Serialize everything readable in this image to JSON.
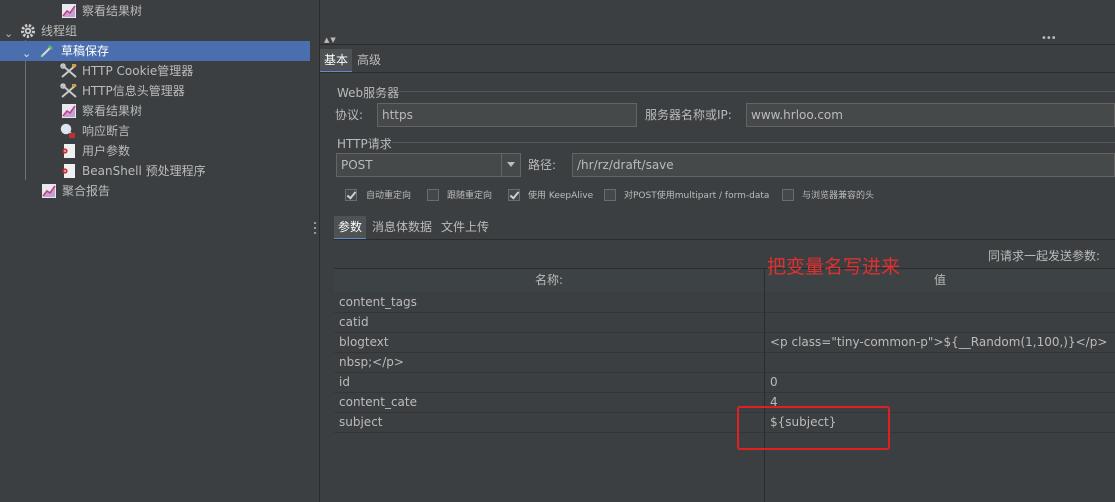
{
  "tree": {
    "items": [
      {
        "label": "察看结果树",
        "icon": "graph-icon"
      },
      {
        "label": "线程组",
        "icon": "gear-icon"
      },
      {
        "label": "草稿保存",
        "icon": "pipette-icon"
      },
      {
        "label": "HTTP Cookie管理器",
        "icon": "wrench-icon"
      },
      {
        "label": "HTTP信息头管理器",
        "icon": "wrench-icon"
      },
      {
        "label": "察看结果树",
        "icon": "graph-icon"
      },
      {
        "label": "响应断言",
        "icon": "magnifier-icon"
      },
      {
        "label": "用户参数",
        "icon": "document-icon"
      },
      {
        "label": "BeanShell 预处理程序",
        "icon": "document-icon"
      },
      {
        "label": "聚合报告",
        "icon": "graph-icon"
      }
    ]
  },
  "tabs": {
    "basic": "基本",
    "advanced": "高级"
  },
  "web_server": {
    "section_title": "Web服务器",
    "protocol_label": "协议:",
    "protocol_value": "https",
    "server_label": "服务器名称或IP:",
    "server_value": "www.hrloo.com"
  },
  "http_request": {
    "section_title": "HTTP请求",
    "method": "POST",
    "path_label": "路径:",
    "path_value": "/hr/rz/draft/save"
  },
  "options": [
    {
      "label": "自动重定向",
      "checked": true
    },
    {
      "label": "跟随重定向",
      "checked": false
    },
    {
      "label": "使用 KeepAlive",
      "checked": true
    },
    {
      "label": "对POST使用multipart / form-data",
      "checked": false
    },
    {
      "label": "与浏览器兼容的头",
      "checked": false
    }
  ],
  "param_tabs": {
    "params": "参数",
    "body_data": "消息体数据",
    "file_upload": "文件上传"
  },
  "send_params_label": "同请求一起发送参数:",
  "table": {
    "col_name": "名称:",
    "col_value": "值",
    "rows": [
      {
        "name": "content_tags",
        "value": ""
      },
      {
        "name": "catid",
        "value": ""
      },
      {
        "name": "blogtext",
        "value": "<p class=\"tiny-common-p\">${__Random(1,100,)}</p>"
      },
      {
        "name": "nbsp;</p>",
        "value": ""
      },
      {
        "name": "id",
        "value": "0"
      },
      {
        "name": "content_cate",
        "value": "4"
      },
      {
        "name": "subject",
        "value": "${subject}"
      }
    ]
  },
  "annotation": {
    "text": "把变量名写进来",
    "color": "#e03030"
  },
  "colors": {
    "selected_row": "#4b6eaf",
    "panel_bg": "#3c3f41",
    "field_bg": "#45494a"
  }
}
